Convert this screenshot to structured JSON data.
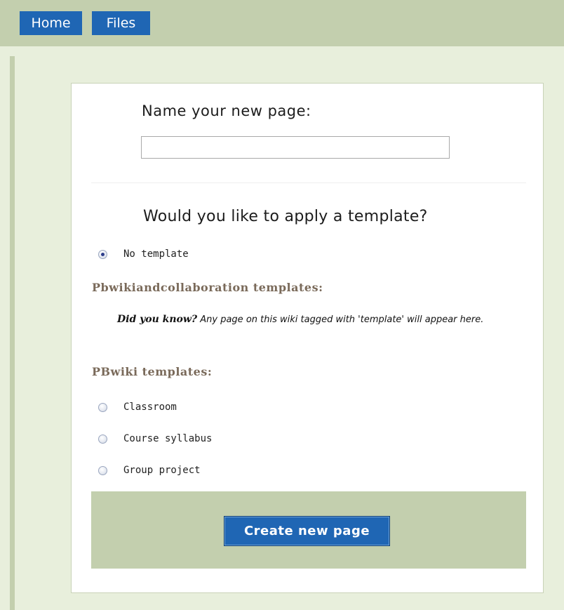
{
  "nav": {
    "tabs": [
      {
        "label": "Home"
      },
      {
        "label": "Files"
      }
    ]
  },
  "form": {
    "name_heading": "Name your new page:",
    "name_value": "",
    "template_heading": "Would you like to apply a template?",
    "no_template_label": "No template",
    "selected": "No template",
    "collab_heading": "Pbwikiandcollaboration templates:",
    "did_you_know_bold": "Did you know?",
    "did_you_know_text": " Any page on this wiki tagged with 'template' will appear here.",
    "pbwiki_heading": "PBwiki templates:",
    "pbwiki_templates": [
      "Classroom",
      "Course syllabus",
      "Group project"
    ],
    "submit_label": "Create new page"
  },
  "colors": {
    "nav_bg": "#c3cfae",
    "tab_bg": "#1f66b4",
    "page_bg": "#e8efdc",
    "heading_brown": "#7a6a5a"
  }
}
